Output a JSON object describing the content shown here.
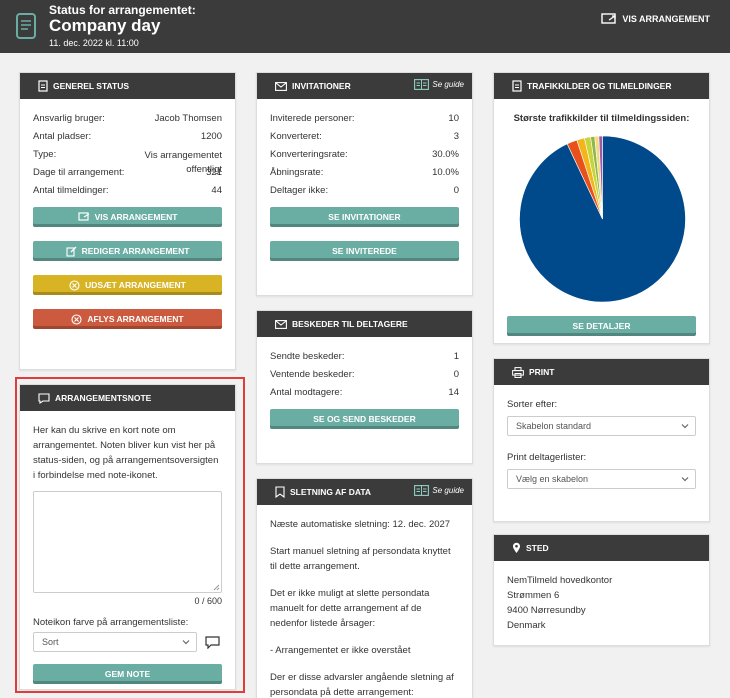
{
  "header": {
    "subtitle": "Status for arrangementet:",
    "title": "Company day",
    "date": "11. dec. 2022 kl. 11:00",
    "vis_label": "VIS ARRANGEMENT"
  },
  "general": {
    "title": "GENEREL STATUS",
    "rows": [
      {
        "label": "Ansvarlig bruger:",
        "value": "Jacob Thomsen"
      },
      {
        "label": "Antal pladser:",
        "value": "1200"
      },
      {
        "label": "Type:",
        "value": "Vis arrangementet offentligt"
      },
      {
        "label": "Dage til arrangement:",
        "value": "321"
      },
      {
        "label": "Antal tilmeldinger:",
        "value": "44"
      }
    ],
    "btn_vis": "VIS ARRANGEMENT",
    "btn_edit": "REDIGER ARRANGEMENT",
    "btn_postpone": "UDSÆT ARRANGEMENT",
    "btn_cancel": "AFLYS ARRANGEMENT"
  },
  "note": {
    "title": "ARRANGEMENTSNOTE",
    "desc": "Her kan du skrive en kort note om arrangementet. Noten bliver kun vist her på status-siden, og på arrangementsoversigten i forbindelse med note-ikonet.",
    "counter": "0 / 600",
    "color_label": "Noteikon farve på arrangementsliste:",
    "color_value": "Sort",
    "save": "GEM NOTE"
  },
  "invitations": {
    "title": "INVITATIONER",
    "guide": "Se guide",
    "rows": [
      {
        "label": "Inviterede personer:",
        "value": "10"
      },
      {
        "label": "Konverteret:",
        "value": "3"
      },
      {
        "label": "Konverteringsrate:",
        "value": "30.0%"
      },
      {
        "label": "Åbningsrate:",
        "value": "10.0%"
      },
      {
        "label": "Deltager ikke:",
        "value": "0"
      }
    ],
    "btn_invitations": "SE INVITATIONER",
    "btn_invited": "SE INVITEREDE"
  },
  "messages": {
    "title": "BESKEDER TIL DELTAGERE",
    "rows": [
      {
        "label": "Sendte beskeder:",
        "value": "1"
      },
      {
        "label": "Ventende beskeder:",
        "value": "0"
      },
      {
        "label": "Antal modtagere:",
        "value": "14"
      }
    ],
    "btn": "SE OG SEND BESKEDER"
  },
  "deletion": {
    "title": "SLETNING AF DATA",
    "guide": "Se guide",
    "p1": "Næste automatiske sletning: 12. dec. 2027",
    "p2": "Start manuel sletning af persondata knyttet til dette arrangement.",
    "p3": "Det er ikke muligt at slette persondata manuelt for dette arrangement af de nedenfor listede årsager:",
    "p4": "- Arrangementet er ikke overstået",
    "p5": "Der er disse advarsler angående sletning af persondata på dette arrangement:"
  },
  "traffic": {
    "title": "TRAFIKKILDER OG TILMELDINGER",
    "chart_title": "Største trafikkilder til tilmeldingssiden:",
    "btn": "SE DETALJER"
  },
  "chart_data": {
    "type": "pie",
    "values": [
      93,
      2,
      1.5,
      1.2,
      0.8,
      0.8,
      0.7
    ],
    "colors": [
      "#004a8c",
      "#e8501c",
      "#f2b51a",
      "#c8d43a",
      "#8fb84c",
      "#f5d97a",
      "#9c5aa8"
    ]
  },
  "print": {
    "title": "PRINT",
    "sort_label": "Sorter efter:",
    "sort_value": "Skabelon standard",
    "list_label": "Print deltagerlister:",
    "list_value": "Vælg en skabelon"
  },
  "place": {
    "title": "STED",
    "lines": [
      "NemTilmeld hovedkontor",
      "Strømmen 6",
      "9400 Nørresundby",
      "Denmark"
    ]
  },
  "colors": {
    "dark": "#3b3b3b",
    "teal": "#6aaea3",
    "yellow": "#d8b323",
    "red": "#cc5a3f",
    "highlight": "#e03c3c"
  }
}
